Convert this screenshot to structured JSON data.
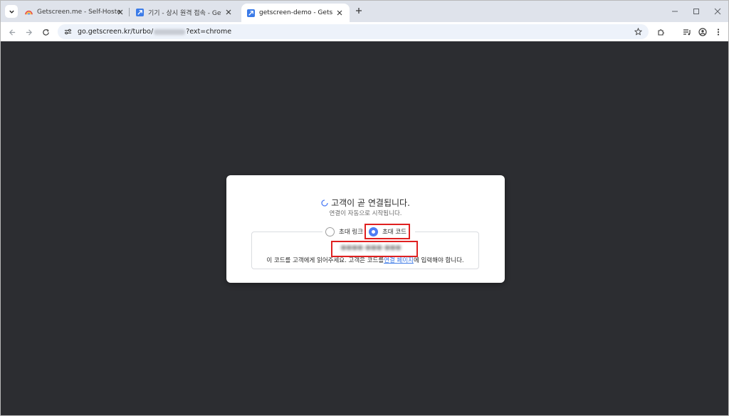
{
  "browser": {
    "tabs": [
      {
        "title": "Getscreen.me - Self-Hosted - I",
        "active": false
      },
      {
        "title": "기기 - 상시 원격 접속 - Getscr",
        "active": false
      },
      {
        "title": "getscreen-demo - Getscreen.m",
        "active": true
      }
    ],
    "url_prefix": "go.getscreen.kr/turbo/",
    "url_suffix": "?ext=chrome"
  },
  "dialog": {
    "title": "고객이 곧 연결됩니다.",
    "subtitle": "연결이 자동으로 시작됩니다.",
    "radio_link_label": "초대 링크",
    "radio_code_label": "초대 코드",
    "selected": "code",
    "instruction_before": "이 코드를 고객에게 읽어주세요. 고객은 코드를",
    "instruction_link": "연결 페이지",
    "instruction_after": "에 입력해야 합니다."
  },
  "colors": {
    "page_bg": "#2c2d31",
    "accent": "#4e7df5",
    "highlight": "#e02020",
    "link": "#3a78e6"
  }
}
